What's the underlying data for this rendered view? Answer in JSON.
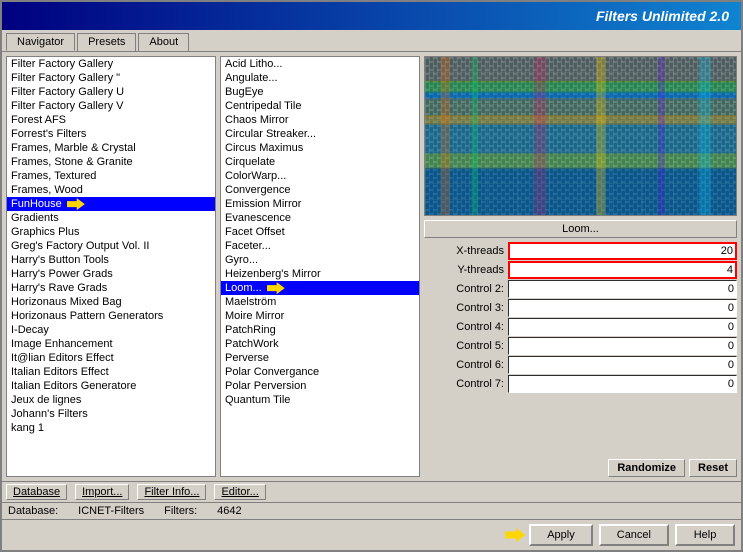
{
  "title": "Filters Unlimited 2.0",
  "tabs": [
    {
      "id": "navigator",
      "label": "Navigator",
      "active": true
    },
    {
      "id": "presets",
      "label": "Presets",
      "active": false
    },
    {
      "id": "about",
      "label": "About",
      "active": false
    }
  ],
  "left_list": {
    "items": [
      "Filter Factory Gallery U",
      "Filter Factory Gallery V",
      "Forest AFS",
      "Forrest's Filters",
      "Frames, Marble & Crystal",
      "Frames, Stone & Granite",
      "Frames, Textured",
      "Frames, Wood",
      "FunHouse",
      "Gradients",
      "Graphics Plus",
      "Greg's Factory Output Vol. II",
      "Harry's Button Tools",
      "Harry's Power Grads",
      "Harry's Rave Grads",
      "Horizonaus Mixed Bag",
      "Horizonaus Pattern Generators",
      "I-Decay",
      "Image Enhancement",
      "It@lian Editors Effect",
      "Italian Editors Effect",
      "Italian Editors Generatore",
      "Jeux de lignes",
      "Johann's Filters",
      "kang 1"
    ],
    "selected_index": 8,
    "scroll_items": [
      "Filter Factory Gallery",
      "Filter Factory Gallery \""
    ]
  },
  "filter_list": {
    "items": [
      "Acid Litho...",
      "Angulate...",
      "BugEye",
      "Centripedal Tile",
      "Chaos Mirror",
      "Circular Streaker...",
      "Circus Maximus",
      "Cirquelate",
      "ColorWarp...",
      "Convergence",
      "Emission Mirror",
      "Evanescence",
      "Facet Offset",
      "Faceter...",
      "Gyro...",
      "Heizenberg's Mirror",
      "Loom...",
      "Maelström",
      "Moire Mirror",
      "PatchRing",
      "PatchWork",
      "Perverse",
      "Polar Convergance",
      "Polar Perversion",
      "Quantum Tile"
    ],
    "selected_index": 16
  },
  "preview": {
    "has_image": true
  },
  "loom_button": "Loom...",
  "controls": [
    {
      "label": "X-threads",
      "value": "20",
      "highlighted": true
    },
    {
      "label": "Y-threads",
      "value": "4",
      "highlighted": true
    },
    {
      "label": "Control 2:",
      "value": "0",
      "highlighted": false
    },
    {
      "label": "Control 3:",
      "value": "0",
      "highlighted": false
    },
    {
      "label": "Control 4:",
      "value": "0",
      "highlighted": false
    },
    {
      "label": "Control 5:",
      "value": "0",
      "highlighted": false
    },
    {
      "label": "Control 6:",
      "value": "0",
      "highlighted": false
    },
    {
      "label": "Control 7:",
      "value": "0",
      "highlighted": false
    }
  ],
  "toolbar": {
    "database": "Database",
    "import": "Import...",
    "filter_info": "Filter Info...",
    "editor": "Editor...",
    "randomize": "Randomize",
    "reset": "Reset"
  },
  "status": {
    "database_label": "Database:",
    "database_value": "ICNET-Filters",
    "filters_label": "Filters:",
    "filters_value": "4642"
  },
  "action_buttons": {
    "apply": "Apply",
    "cancel": "Cancel",
    "help": "Help"
  }
}
